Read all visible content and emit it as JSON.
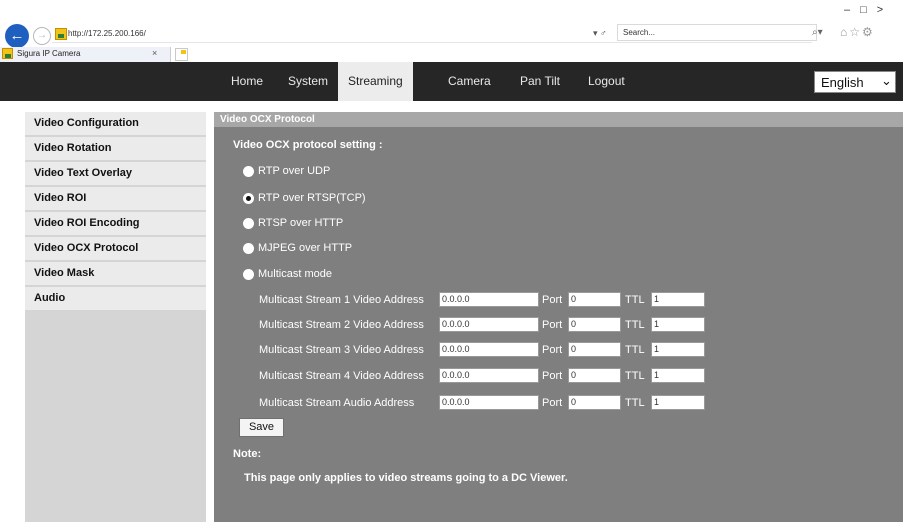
{
  "browser": {
    "url": "http://172.25.200.166/",
    "search_placeholder": "Search...",
    "tab_title": "Sigura IP Camera",
    "tab_close": "×",
    "addr_dropdown": "▾ ♂",
    "search_glass": "⌕▾",
    "chrome_icons": "⌂☆⚙",
    "window_controls": "–□>"
  },
  "nav": {
    "items": [
      {
        "label": "Home"
      },
      {
        "label": "System"
      },
      {
        "label": "Streaming",
        "active": true
      },
      {
        "label": "Camera"
      },
      {
        "label": "Pan Tilt"
      },
      {
        "label": "Logout"
      }
    ],
    "language": "English"
  },
  "sidebar": {
    "items": [
      {
        "label": "Video Configuration"
      },
      {
        "label": "Video Rotation"
      },
      {
        "label": "Video Text Overlay"
      },
      {
        "label": "Video ROI"
      },
      {
        "label": "Video ROI Encoding"
      },
      {
        "label": "Video OCX Protocol"
      },
      {
        "label": "Video Mask"
      },
      {
        "label": "Audio"
      }
    ]
  },
  "main": {
    "header": "Video OCX Protocol",
    "setting_title": "Video OCX protocol setting :",
    "protocols": [
      {
        "label": "RTP over UDP",
        "checked": false
      },
      {
        "label": "RTP over RTSP(TCP)",
        "checked": true
      },
      {
        "label": "RTSP over HTTP",
        "checked": false
      },
      {
        "label": "MJPEG over HTTP",
        "checked": false
      },
      {
        "label": "Multicast mode",
        "checked": false
      }
    ],
    "multicast": [
      {
        "label": "Multicast Stream 1 Video Address",
        "address": "0.0.0.0",
        "port": "0",
        "ttl": "1"
      },
      {
        "label": "Multicast Stream 2 Video Address",
        "address": "0.0.0.0",
        "port": "0",
        "ttl": "1"
      },
      {
        "label": "Multicast Stream 3 Video Address",
        "address": "0.0.0.0",
        "port": "0",
        "ttl": "1"
      },
      {
        "label": "Multicast Stream 4 Video Address",
        "address": "0.0.0.0",
        "port": "0",
        "ttl": "1"
      },
      {
        "label": "Multicast Stream Audio Address",
        "address": "0.0.0.0",
        "port": "0",
        "ttl": "1"
      }
    ],
    "port_label": "Port",
    "ttl_label": "TTL",
    "save_label": "Save",
    "note_label": "Note:",
    "note_text": "This page only applies to video streams going to a DC Viewer."
  }
}
